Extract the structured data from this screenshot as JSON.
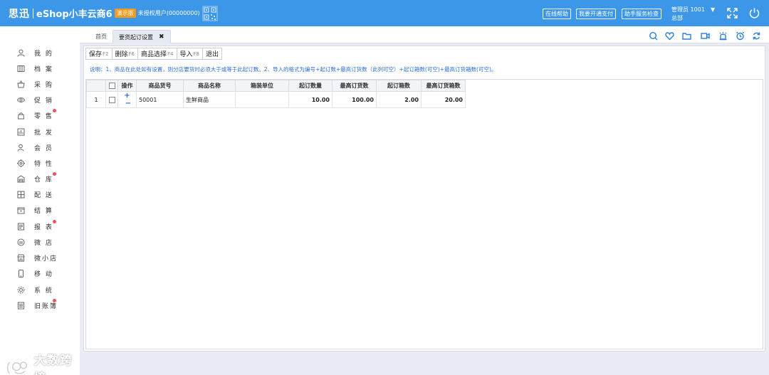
{
  "header": {
    "brand_cn": "思迅",
    "brand_product": "eShop小丰云商6",
    "demo_badge": "演示版",
    "auth_text": "未授权用户(00000000)",
    "btn_help": "在线帮助",
    "btn_pay": "我要开通支付",
    "btn_check": "助手服务检查",
    "user_name": "管理员 1001",
    "user_org": "总部",
    "user_caret": "▼",
    "icons": [
      "qr-code-icon",
      "fullscreen-icon",
      "power-icon"
    ]
  },
  "sidebar": {
    "items": [
      {
        "label": "我 的",
        "icon": "user-icon",
        "dot": false
      },
      {
        "label": "档 案",
        "icon": "book-icon",
        "dot": false
      },
      {
        "label": "采 购",
        "icon": "basket-icon",
        "dot": false
      },
      {
        "label": "促 销",
        "icon": "eye-icon",
        "dot": false
      },
      {
        "label": "零 售",
        "icon": "bag-icon",
        "dot": true
      },
      {
        "label": "批 发",
        "icon": "chart-icon",
        "dot": false
      },
      {
        "label": "会 员",
        "icon": "member-icon",
        "dot": false
      },
      {
        "label": "特 性",
        "icon": "target-icon",
        "dot": false
      },
      {
        "label": "仓 库",
        "icon": "warehouse-icon",
        "dot": true
      },
      {
        "label": "配 送",
        "icon": "delivery-icon",
        "dot": false
      },
      {
        "label": "结 算",
        "icon": "settle-icon",
        "dot": false
      },
      {
        "label": "报 表",
        "icon": "report-icon",
        "dot": true
      },
      {
        "label": "微 店",
        "icon": "microshop-icon",
        "dot": false
      },
      {
        "label": "微小店",
        "icon": "store-icon",
        "dot": false
      },
      {
        "label": "移 动",
        "icon": "mobile-icon",
        "dot": false
      },
      {
        "label": "系 统",
        "icon": "gear-icon",
        "dot": false
      },
      {
        "label": "旧账簿",
        "icon": "ledger-icon",
        "dot": true
      }
    ],
    "watermark": "大数跨境"
  },
  "tabs": {
    "home": "首页",
    "active": "要货起订设置",
    "close": "✖",
    "tools": [
      "search-icon",
      "heart-icon",
      "folder-icon",
      "video-icon",
      "alarm-icon",
      "clock-icon",
      "refresh-icon"
    ]
  },
  "toolbar": {
    "save": "保存",
    "save_key": "F2",
    "delete": "删除",
    "delete_key": "F6",
    "select": "商品选择",
    "select_key": "F4",
    "import": "导入",
    "import_key": "F8",
    "exit": "退出"
  },
  "notice": "说明：1、商品在此处如有设置，则分店要货时必须大于或等于此起订数。2、导入的格式为编号+起订数+最高订货数（此列可空）+起订箱数(可空)+最高订货箱数(可空)。",
  "grid": {
    "columns": [
      "",
      "",
      "操作",
      "商品货号",
      "商品名称",
      "箱装单位",
      "起订数量",
      "最高订货数",
      "起订箱数",
      "最高订货箱数"
    ],
    "rows": [
      {
        "index": "1",
        "plus": "+",
        "minus": "−",
        "sku": "50001",
        "name": "生鲜商品",
        "unit": "",
        "min_qty": "10.00",
        "max_qty": "100.00",
        "min_box": "2.00",
        "max_box": "20.00"
      }
    ]
  },
  "colors": {
    "header_bg": "#3d97e8",
    "badge": "#f39a1e",
    "accent": "#2a6fd6",
    "dot": "#f05454"
  }
}
